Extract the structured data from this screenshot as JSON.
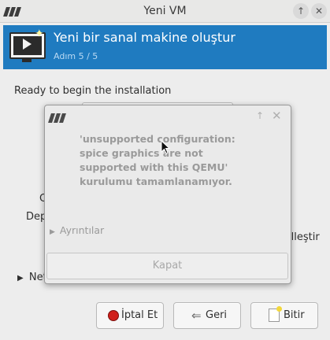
{
  "window": {
    "title": "Yeni VM"
  },
  "banner": {
    "title": "Yeni bir sanal makine oluştur",
    "step": "Adım 5 / 5"
  },
  "content": {
    "ready_text": "Ready to begin the installation",
    "fragment_left_1": "C",
    "fragment_left_2": "Dep",
    "fragment_right": "ılleştir",
    "network_label": "Net"
  },
  "buttons": {
    "cancel": "İptal Et",
    "back": "Geri",
    "finish": "Bitir"
  },
  "dialog": {
    "message": "'unsupported configuration: spice graphics are not supported with this QEMU' kurulumu tamamlanamıyor.",
    "details": "Ayrıntılar",
    "close": "Kapat"
  }
}
